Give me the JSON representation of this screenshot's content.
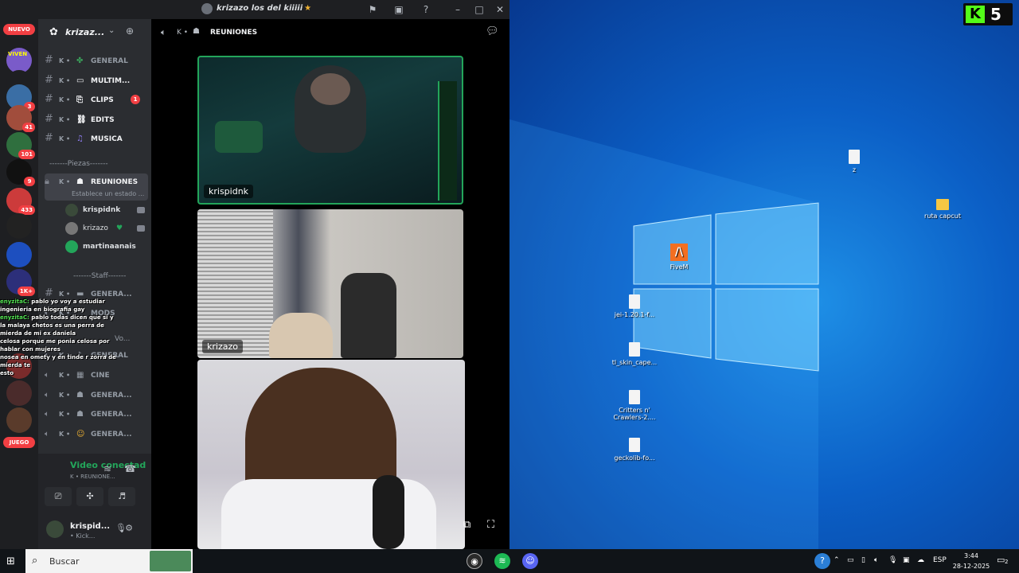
{
  "window": {
    "title": "krizazo los del kiiiii",
    "star": "★"
  },
  "rail": {
    "nuevo": "NUEVO",
    "badges": [
      "3",
      "41",
      "101",
      "9",
      "433",
      "1K+"
    ],
    "mark_label": "VIVEN",
    "bottom_label": "JUEGO"
  },
  "server": {
    "name": "krizaz..."
  },
  "channels": [
    {
      "prefix": "K •",
      "emoji": "✤",
      "name": "GENERAL"
    },
    {
      "prefix": "K •",
      "emoji": "▭",
      "name": "MULTIM..."
    },
    {
      "prefix": "K •",
      "emoji": "⎘",
      "name": "CLIPS",
      "unread": "1"
    },
    {
      "prefix": "K •",
      "emoji": "⛓",
      "name": "EDITS"
    },
    {
      "prefix": "K •",
      "emoji": "♫",
      "name": "MUSICA"
    }
  ],
  "categories": {
    "piezas": "-------Piezas-------",
    "staff": "-------Staff-------",
    "voz": "Vo..."
  },
  "active_channel": {
    "prefix": "K •",
    "name": "REUNIONES",
    "status": "Establece un estado ..."
  },
  "voice_members": [
    "krispidnk",
    "krizazo",
    "martinaanais"
  ],
  "staff_channels": [
    {
      "prefix": "K •",
      "name": "GENERA..."
    },
    {
      "prefix": "K •",
      "name": "MODS"
    }
  ],
  "voice_channels": [
    {
      "prefix": "K •",
      "name": "GENERAL"
    },
    {
      "prefix": "K •",
      "name": "CINE"
    },
    {
      "prefix": "K •",
      "name": "GENERA..."
    },
    {
      "prefix": "K •",
      "name": "GENERA..."
    },
    {
      "prefix": "K •",
      "name": "GENERA..."
    }
  ],
  "voice_panel": {
    "status": "Video conectad",
    "channel": "K • REUNIONE..."
  },
  "user": {
    "name": "krispid...",
    "sub": "• Kick..."
  },
  "stage": {
    "title": "REUNIONES",
    "prefix": "K •",
    "tiles": [
      "krispidnk",
      "krizazo"
    ]
  },
  "overlay_chat": [
    {
      "user": "enyzitaC:",
      "text": "pablo yo voy a estudiar ingenieria en biografia gay"
    },
    {
      "user": "enyzitaC:",
      "text": "pablo todas dicen que si y la malaya chetos es una perra de mierda de mi ex daniela"
    },
    {
      "user": "",
      "text": "celosa porque me ponia celosa por hablar con mujeres"
    },
    {
      "user": "",
      "text": "nosea en omety y en tinde r zorra de mierda te"
    },
    {
      "user": "",
      "text": "esto"
    }
  ],
  "desktop_icons": [
    {
      "label": "z",
      "kind": "file"
    },
    {
      "label": "ruta capcut",
      "kind": "folder"
    },
    {
      "label": "FiveM",
      "kind": "app"
    },
    {
      "label": "jei-1.20.1-f...",
      "kind": "file"
    },
    {
      "label": "tl_skin_cape...",
      "kind": "file"
    },
    {
      "label": "Critters n' Crawlers-2....",
      "kind": "file"
    },
    {
      "label": "geckolib-fo...",
      "kind": "file"
    }
  ],
  "kick_badge": {
    "letter": "K",
    "count": "5"
  },
  "taskbar": {
    "search_placeholder": "Buscar",
    "lang": "ESP",
    "time": "3:44",
    "date": "28-12-2025",
    "notif_count": "2"
  },
  "colors": {
    "discord_bg": "#1e1f22",
    "sidebar_bg": "#2b2d31",
    "accent_green": "#23a55a",
    "badge_red": "#f23f43",
    "kick_green": "#53fc18"
  }
}
